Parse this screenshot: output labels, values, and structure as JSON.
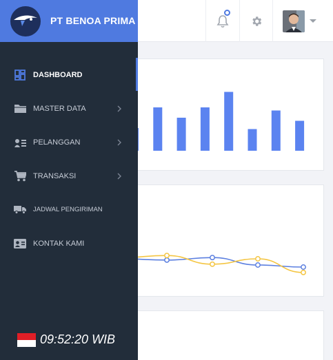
{
  "brand": {
    "name": "PT BENOA PRIMA",
    "color": "#4f7ae0"
  },
  "topbar": {
    "icons": [
      "bell-icon",
      "gear-icon",
      "user-avatar",
      "chevron-down-icon"
    ],
    "notification_dot": true
  },
  "sidebar": {
    "items": [
      {
        "label": "DASHBOARD",
        "icon": "dashboard-icon",
        "active": true,
        "has_submenu": false
      },
      {
        "label": "MASTER DATA",
        "icon": "folder-icon",
        "active": false,
        "has_submenu": true
      },
      {
        "label": "PELANGGAN",
        "icon": "customers-icon",
        "active": false,
        "has_submenu": true
      },
      {
        "label": "TRANSAKSI",
        "icon": "cart-icon",
        "active": false,
        "has_submenu": true
      },
      {
        "label": "JADWAL PENGIRIMAN",
        "icon": "truck-icon",
        "active": false,
        "has_submenu": false
      },
      {
        "label": "KONTAK KAMI",
        "icon": "contact-card-icon",
        "active": false,
        "has_submenu": false
      }
    ],
    "clock": {
      "time": "09:52:20 WIB",
      "flag": "indonesia-flag"
    }
  },
  "chart_data": [
    {
      "type": "bar",
      "values": [
        22,
        42,
        32,
        42,
        57,
        21,
        39,
        29
      ],
      "color": "#5b83f0",
      "ylim": [
        0,
        80
      ],
      "grid": false
    },
    {
      "type": "line",
      "series": [
        {
          "values": [
            45,
            42,
            48,
            30,
            25
          ],
          "color": "#5b7fe0"
        },
        {
          "values": [
            48,
            53,
            32,
            45,
            12
          ],
          "color": "#f4c542"
        }
      ],
      "ylim": [
        0,
        100
      ],
      "grid": false
    }
  ]
}
